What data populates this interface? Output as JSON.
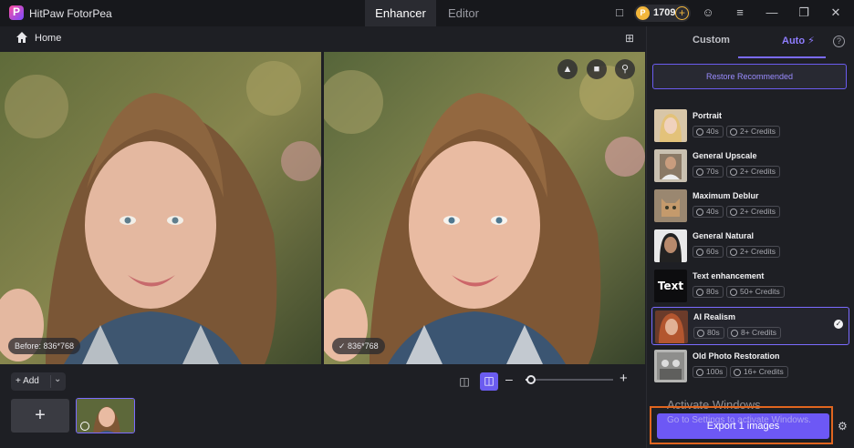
{
  "app": {
    "title": "HitPaw FotorPea",
    "credits": "1709"
  },
  "top_tabs": {
    "enhancer": "Enhancer",
    "editor": "Editor"
  },
  "home": {
    "label": "Home"
  },
  "preview": {
    "before_label": "Before: 836*768",
    "after_label": "836*768"
  },
  "toolbar": {
    "add_label": "Add",
    "zoom_level_fraction": 0.06
  },
  "panel": {
    "tab_custom": "Custom",
    "tab_auto": "Auto",
    "restore_label": "Restore Recommended",
    "models": [
      {
        "name": "Portrait",
        "time": "40s",
        "credits": "2+ Credits",
        "thumb": "face-blonde"
      },
      {
        "name": "General Upscale",
        "time": "70s",
        "credits": "2+ Credits",
        "thumb": "portrait-boy"
      },
      {
        "name": "Maximum Deblur",
        "time": "40s",
        "credits": "2+ Credits",
        "thumb": "cat"
      },
      {
        "name": "General Natural",
        "time": "60s",
        "credits": "2+ Credits",
        "thumb": "face-dark"
      },
      {
        "name": "Text enhancement",
        "time": "80s",
        "credits": "50+ Credits",
        "thumb_text": "Text"
      },
      {
        "name": "AI Realism",
        "time": "80s",
        "credits": "8+ Credits",
        "thumb": "face-red",
        "selected": true
      },
      {
        "name": "Old Photo Restoration",
        "time": "100s",
        "credits": "16+ Credits",
        "thumb": "old-photo"
      }
    ]
  },
  "export": {
    "label": "Export 1 images"
  },
  "watermark": {
    "line1": "Activate Windows",
    "line2": "Go to Settings to activate Windows."
  },
  "colors": {
    "accent": "#6d58f5",
    "highlight_outline": "#e0651f",
    "background": "#1e1f24"
  }
}
